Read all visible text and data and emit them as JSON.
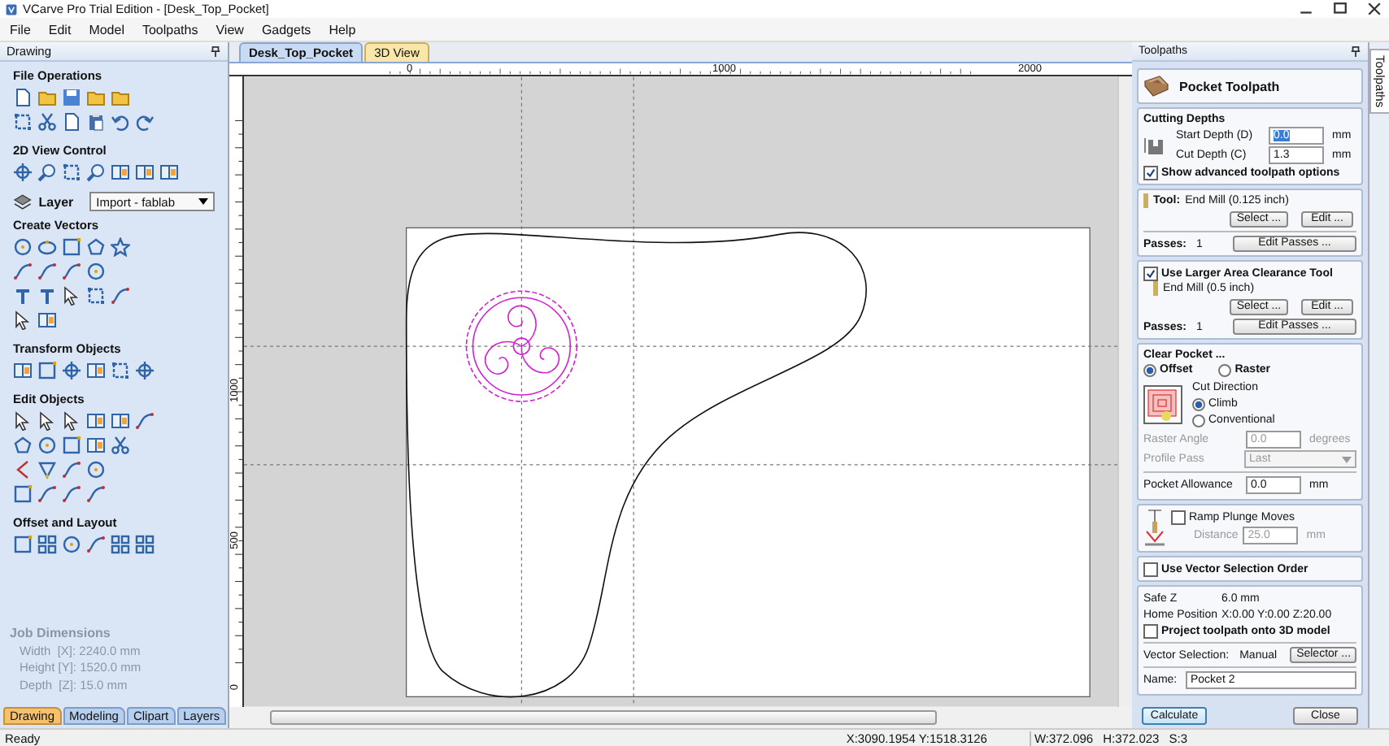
{
  "window": {
    "title": "VCarve Pro Trial Edition - [Desk_Top_Pocket]"
  },
  "menu": [
    "File",
    "Edit",
    "Model",
    "Toolpaths",
    "View",
    "Gadgets",
    "Help"
  ],
  "drawing_panel": {
    "title": "Drawing",
    "sections": [
      {
        "kind": "tools",
        "title": "File Operations"
      },
      {
        "kind": "tools",
        "title": "2D View Control"
      },
      {
        "kind": "layer",
        "title": "Layer",
        "value": "Import - fablab"
      },
      {
        "kind": "tools",
        "title": "Create Vectors"
      },
      {
        "kind": "tools",
        "title": "Transform Objects"
      },
      {
        "kind": "tools",
        "title": "Edit Objects"
      },
      {
        "kind": "tools",
        "title": "Offset and Layout"
      }
    ],
    "job_dimensions": {
      "title": "Job Dimensions",
      "lines": [
        "Width  [X]: 2240.0 mm",
        "Height [Y]: 1520.0 mm",
        "Depth  [Z]: 15.0 mm"
      ]
    },
    "tabs": [
      {
        "label": "Drawing",
        "selected": true
      },
      {
        "label": "Modeling",
        "selected": false
      },
      {
        "label": "Clipart",
        "selected": false
      },
      {
        "label": "Layers",
        "selected": false
      }
    ]
  },
  "document_tabs": [
    {
      "label": "Desk_Top_Pocket",
      "selected": true
    },
    {
      "label": "3D View",
      "selected": false
    }
  ],
  "rulers": {
    "top_labels": [
      "0",
      "1000",
      "2000"
    ],
    "left_labels": [
      "1000",
      "500",
      "0"
    ]
  },
  "toolpaths_panel": {
    "title": "Toolpaths",
    "header": "Pocket Toolpath",
    "cutting_depths": {
      "title": "Cutting Depths",
      "fields": [
        {
          "label": "Start Depth (D)",
          "value": "0.0",
          "unit": "mm",
          "selected": true
        },
        {
          "label": "Cut Depth (C)",
          "value": "1.3",
          "unit": "mm",
          "selected": false
        }
      ],
      "advanced": {
        "label": "Show advanced toolpath options",
        "checked": true
      }
    },
    "tool": {
      "label": "Tool:",
      "name": "End Mill (0.125 inch)",
      "buttons": [
        "Select ...",
        "Edit ..."
      ],
      "passes_label": "Passes:",
      "passes": "1",
      "passes_button": "Edit Passes ..."
    },
    "clearance_tool": {
      "label": "Use Larger Area Clearance Tool",
      "checked": true,
      "name": "End Mill (0.5 inch)",
      "buttons": [
        "Select ...",
        "Edit ..."
      ],
      "passes_label": "Passes:",
      "passes": "1",
      "passes_button": "Edit Passes ..."
    },
    "clear_pocket": {
      "title": "Clear Pocket ...",
      "styles": [
        {
          "label": "Offset",
          "selected": true
        },
        {
          "label": "Raster",
          "selected": false
        }
      ],
      "cut_direction": {
        "title": "Cut Direction",
        "options": [
          {
            "label": "Climb",
            "selected": true
          },
          {
            "label": "Conventional",
            "selected": false
          }
        ]
      },
      "raster_angle": {
        "label": "Raster Angle",
        "value": "0.0",
        "unit": "degrees",
        "disabled": true
      },
      "profile_pass": {
        "label": "Profile Pass",
        "value": "Last",
        "disabled": true
      },
      "allowance": {
        "label": "Pocket Allowance",
        "value": "0.0",
        "unit": "mm"
      }
    },
    "ramp": {
      "label": "Ramp Plunge Moves",
      "checked": false,
      "distance_label": "Distance",
      "value": "25.0",
      "unit": "mm"
    },
    "vector_order": {
      "label": "Use Vector Selection Order",
      "checked": false
    },
    "summary": {
      "safe_z_label": "Safe Z",
      "safe_z": "6.0 mm",
      "home_label": "Home Position",
      "home": "X:0.00 Y:0.00 Z:20.00",
      "project": {
        "label": "Project toolpath onto 3D model",
        "checked": false
      },
      "selection_label": "Vector Selection:",
      "selection": "Manual",
      "selector_button": "Selector ...",
      "name_label": "Name:",
      "name": "Pocket 2"
    },
    "buttons": [
      "Calculate",
      "Close"
    ]
  },
  "side_tab": {
    "label": "Toolpaths"
  },
  "status_bar": [
    "Ready",
    "X:3090.1954 Y:1518.3126",
    "W:372.096",
    "H:372.023",
    "S:3"
  ]
}
